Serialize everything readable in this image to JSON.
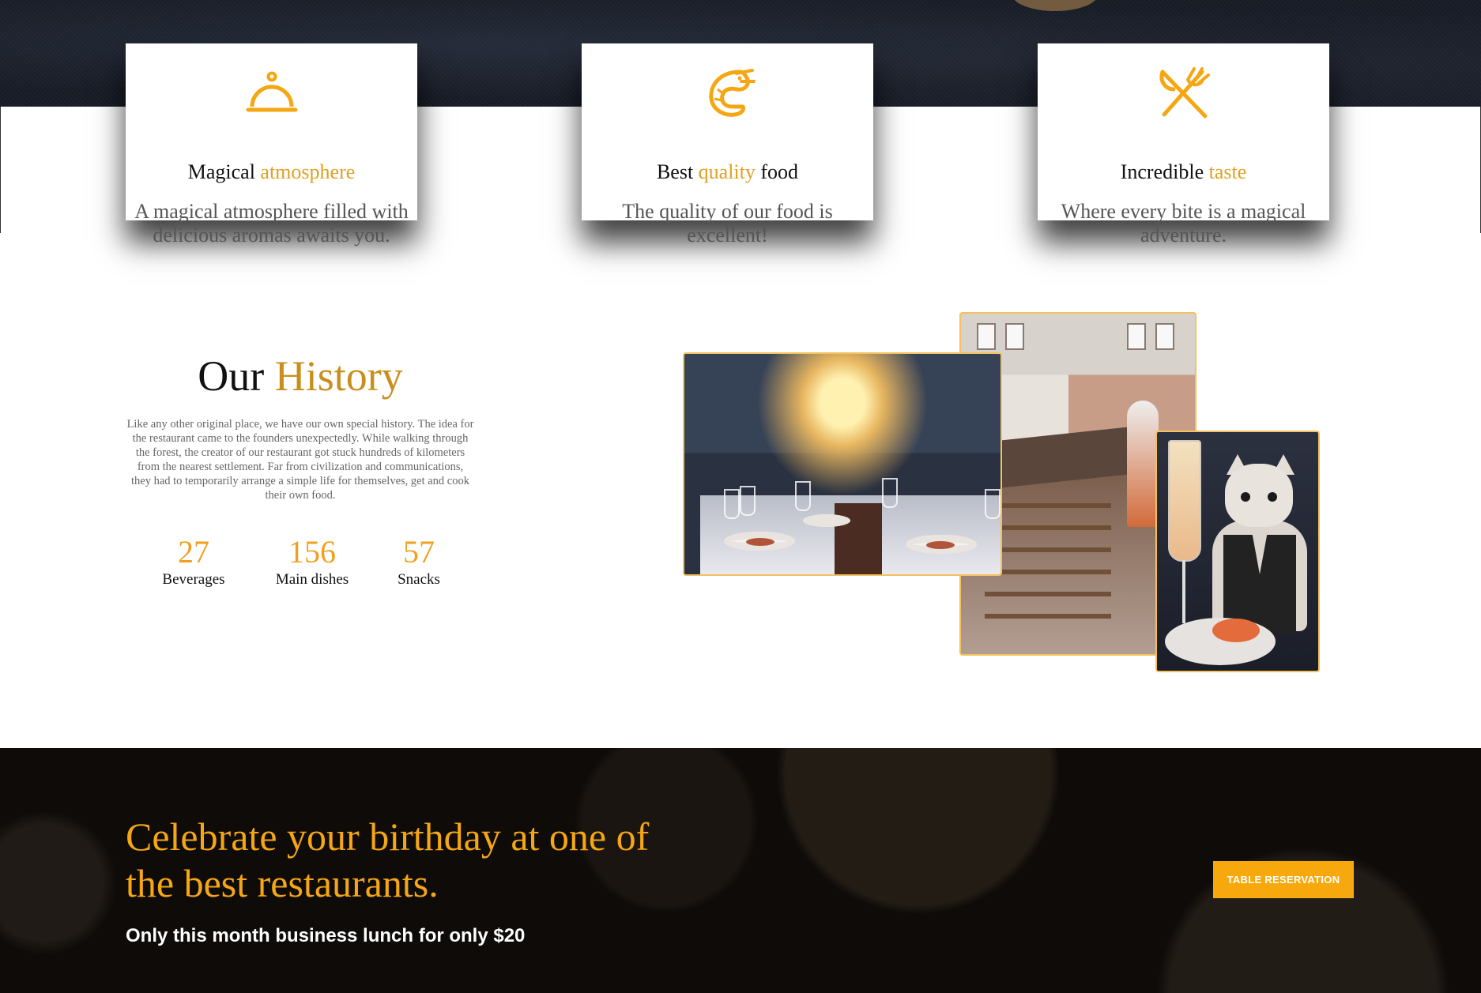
{
  "features": [
    {
      "icon": "cloche-icon",
      "title_plain": "Magical",
      "title_accent": "atmosphere",
      "title_suffix": "",
      "text": "A magical atmosphere filled with delicious aromas awaits you."
    },
    {
      "icon": "shrimp-icon",
      "title_plain": "Best",
      "title_accent": "quality",
      "title_suffix": "food",
      "text": "The quality of our food is excellent!"
    },
    {
      "icon": "fork-knife-icon",
      "title_plain": "Incredible",
      "title_accent": "taste",
      "title_suffix": "",
      "text": "Where every bite is a magical adventure."
    }
  ],
  "history": {
    "title_plain": "Our",
    "title_accent": "History",
    "text": "Like any other original place, we have our own special history. The idea for the restaurant came to the founders unexpectedly. While walking through the forest, the creator of our restaurant got stuck hundreds of kilometers from the nearest settlement. Far from civilization and communications, they had to temporarily arrange a simple life for themselves, get and cook their own food.",
    "stats": [
      {
        "value": "27",
        "label": "Beverages"
      },
      {
        "value": "156",
        "label": "Main dishes"
      },
      {
        "value": "57",
        "label": "Snacks"
      }
    ]
  },
  "promo": {
    "title": "Celebrate your birthday at one of the best restaurants.",
    "subtitle": "Only this month business lunch for only $20",
    "button_label": "TABLE RESERVATION"
  },
  "colors": {
    "accent": "#f5a713",
    "accent_dark": "#c88f1e",
    "promo_bg": "#0e0b09",
    "top_band": "#1a1e27"
  }
}
